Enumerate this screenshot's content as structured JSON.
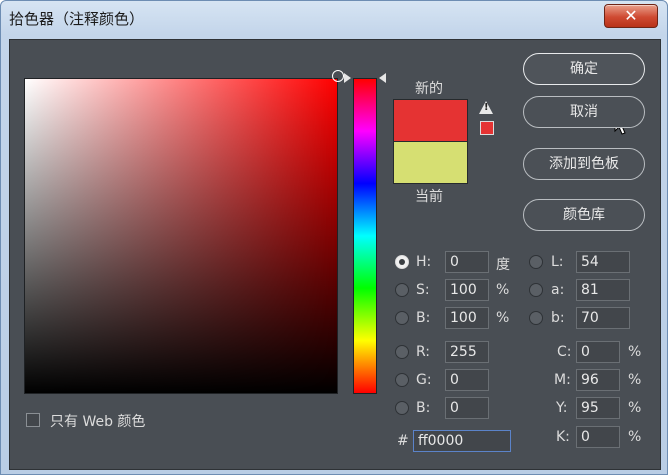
{
  "window": {
    "title": "拾色器（注释颜色）",
    "close_glyph": "✕"
  },
  "preview": {
    "new_label": "新的",
    "current_label": "当前",
    "new_color": "#e53333",
    "current_color": "#d6df72"
  },
  "buttons": {
    "ok": "确定",
    "cancel": "取消",
    "add_swatch": "添加到色板",
    "color_library": "颜色库"
  },
  "hsb": {
    "h": {
      "label": "H:",
      "value": "0",
      "unit": "度",
      "checked": true
    },
    "s": {
      "label": "S:",
      "value": "100",
      "unit": "%"
    },
    "b": {
      "label": "B:",
      "value": "100",
      "unit": "%"
    }
  },
  "rgb": {
    "r": {
      "label": "R:",
      "value": "255"
    },
    "g": {
      "label": "G:",
      "value": "0"
    },
    "b": {
      "label": "B:",
      "value": "0"
    }
  },
  "lab": {
    "l": {
      "label": "L:",
      "value": "54"
    },
    "a": {
      "label": "a:",
      "value": "81"
    },
    "b": {
      "label": "b:",
      "value": "70"
    }
  },
  "cmyk": {
    "c": {
      "label": "C:",
      "value": "0",
      "unit": "%"
    },
    "m": {
      "label": "M:",
      "value": "96",
      "unit": "%"
    },
    "y": {
      "label": "Y:",
      "value": "95",
      "unit": "%"
    },
    "k": {
      "label": "K:",
      "value": "0",
      "unit": "%"
    }
  },
  "hex": {
    "label": "#",
    "value": "ff0000"
  },
  "web_only": {
    "label": "只有 Web 颜色",
    "checked": false
  },
  "icons": {
    "warning": "out-of-gamut-warning-icon",
    "cursor": "mouse-pointer-icon"
  }
}
